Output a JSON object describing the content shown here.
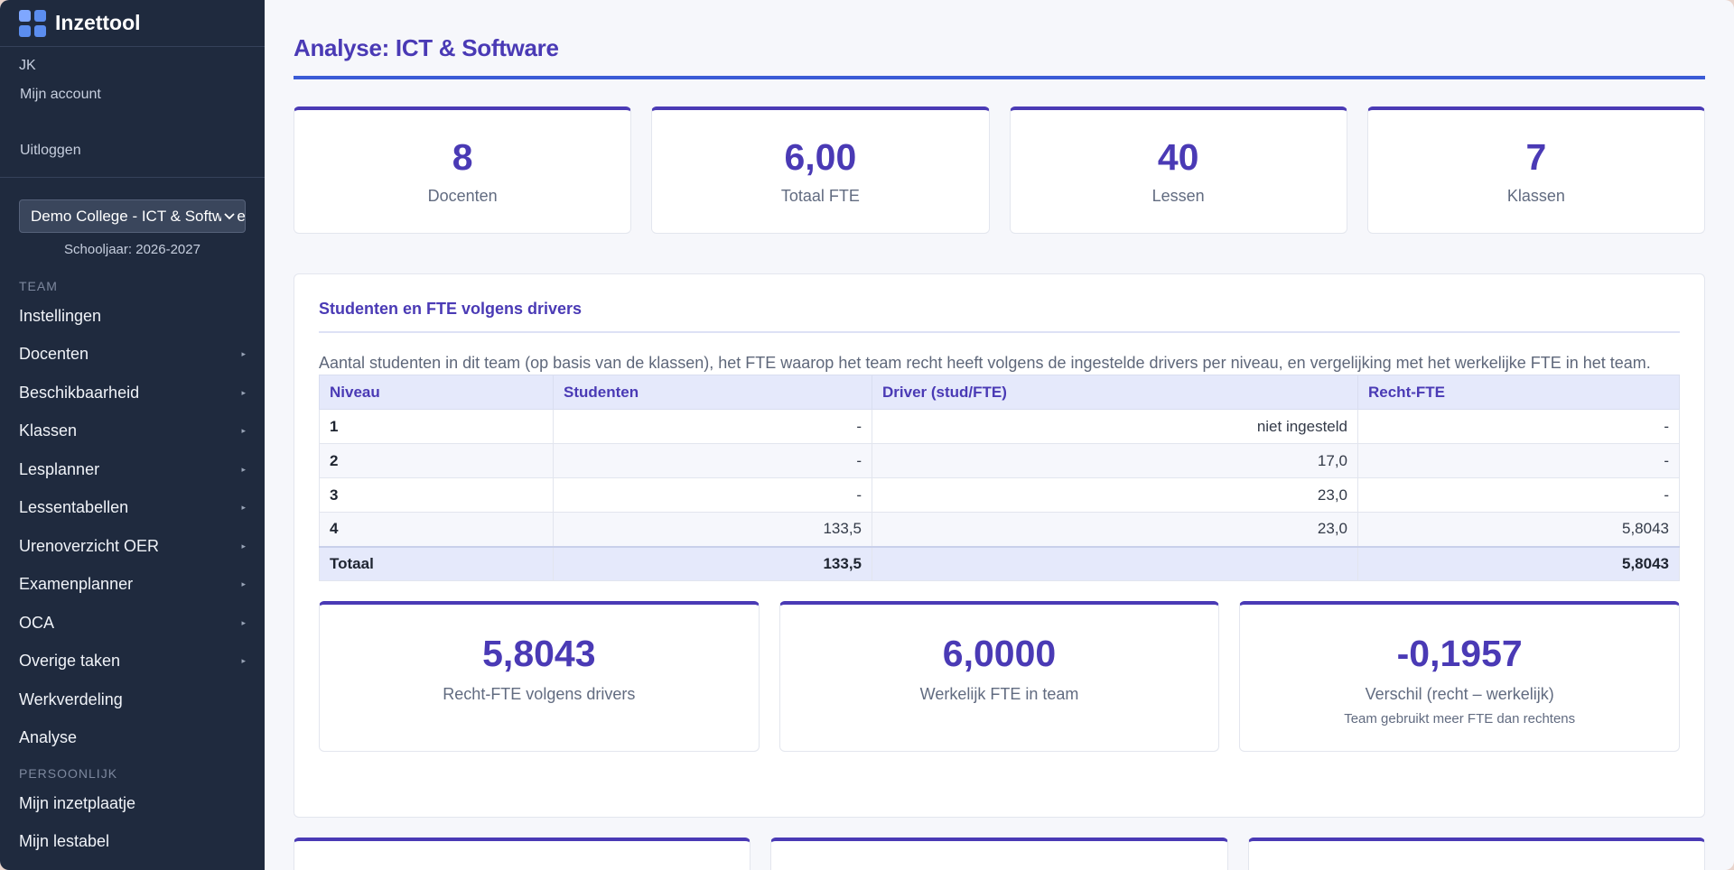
{
  "brand": {
    "title": "Inzettool",
    "logo_icon": "grid-logo-icon"
  },
  "user": {
    "initials": "JK",
    "account_link": "Mijn account",
    "logout_link": "Uitloggen"
  },
  "team_select": {
    "value": "Demo College - ICT & Software"
  },
  "schooljaar": "Schooljaar: 2026-2027",
  "sidebar": {
    "section_team": "TEAM",
    "items": [
      {
        "label": "Instellingen",
        "arrow": ""
      },
      {
        "label": "Docenten",
        "arrow": "▸"
      },
      {
        "label": "Beschikbaarheid",
        "arrow": "▸"
      },
      {
        "label": "Klassen",
        "arrow": "▸"
      },
      {
        "label": "Lesplanner",
        "arrow": "▸"
      },
      {
        "label": "Lessentabellen",
        "arrow": "▸"
      },
      {
        "label": "Urenoverzicht OER",
        "arrow": "▸"
      },
      {
        "label": "Examenplanner",
        "arrow": "▸"
      },
      {
        "label": "OCA",
        "arrow": "▸"
      },
      {
        "label": "Overige taken",
        "arrow": "▸"
      },
      {
        "label": "Werkverdeling",
        "arrow": ""
      },
      {
        "label": "Analyse",
        "arrow": ""
      }
    ],
    "section_personal": "PERSOONLIJK",
    "personal_items": [
      {
        "label": "Mijn inzetplaatje"
      },
      {
        "label": "Mijn lestabel"
      }
    ]
  },
  "main": {
    "title": "Analyse: ICT & Software",
    "kpis": [
      {
        "value": "8",
        "label": "Docenten"
      },
      {
        "value": "6,00",
        "label": "Totaal FTE"
      },
      {
        "value": "40",
        "label": "Lessen"
      },
      {
        "value": "7",
        "label": "Klassen"
      }
    ],
    "panel": {
      "title": "Studenten en FTE volgens drivers",
      "description": "Aantal studenten in dit team (op basis van de klassen), het FTE waarop het team recht heeft volgens de ingestelde drivers per niveau, en vergelijking met het werkelijke FTE in het team.",
      "table": {
        "headers": [
          "Niveau",
          "Studenten",
          "Driver (stud/FTE)",
          "Recht-FTE"
        ],
        "rows": [
          {
            "niveau": "1",
            "studenten": "-",
            "driver": "niet ingesteld",
            "recht": "-"
          },
          {
            "niveau": "2",
            "studenten": "-",
            "driver": "17,0",
            "recht": "-"
          },
          {
            "niveau": "3",
            "studenten": "-",
            "driver": "23,0",
            "recht": "-"
          },
          {
            "niveau": "4",
            "studenten": "133,5",
            "driver": "23,0",
            "recht": "5,8043"
          }
        ],
        "total": {
          "niveau": "Totaal",
          "studenten": "133,5",
          "driver": "",
          "recht": "5,8043"
        }
      },
      "sub_kpis": [
        {
          "value": "5,8043",
          "label": "Recht-FTE volgens drivers",
          "note": ""
        },
        {
          "value": "6,0000",
          "label": "Werkelijk FTE in team",
          "note": ""
        },
        {
          "value": "-0,1957",
          "label": "Verschil (recht – werkelijk)",
          "note": "Team gebruikt meer FTE dan rechtens"
        }
      ]
    }
  },
  "colors": {
    "accent": "#4a3ab5",
    "sidebar_bg": "#1f2a3e",
    "title_rule": "#3b5bd6"
  }
}
